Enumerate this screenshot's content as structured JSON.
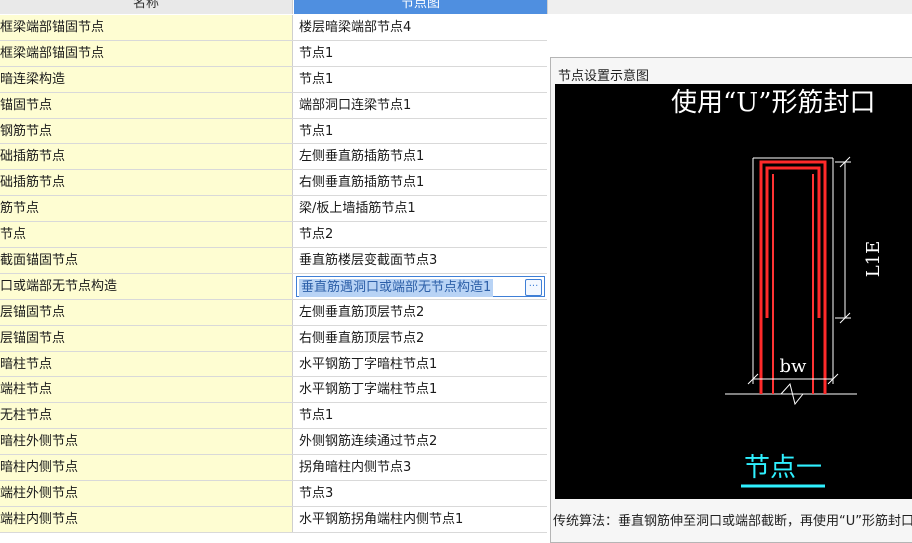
{
  "table": {
    "headers": {
      "name": "名称",
      "diagram": "节点图"
    },
    "rows": [
      {
        "name": "框梁端部锚固节点",
        "value": "楼层暗梁端部节点4"
      },
      {
        "name": "框梁端部锚固节点",
        "value": "节点1"
      },
      {
        "name": "暗连梁构造",
        "value": "节点1"
      },
      {
        "name": "锚固节点",
        "value": "端部洞口连梁节点1"
      },
      {
        "name": "钢筋节点",
        "value": "节点1"
      },
      {
        "name": "础插筋节点",
        "value": "左侧垂直筋插筋节点1"
      },
      {
        "name": "础插筋节点",
        "value": "右侧垂直筋插筋节点1"
      },
      {
        "name": "筋节点",
        "value": "梁/板上墙插筋节点1"
      },
      {
        "name": "节点",
        "value": "节点2"
      },
      {
        "name": "截面锚固节点",
        "value": "垂直筋楼层变截面节点3"
      },
      {
        "name": "口或端部无节点构造",
        "value": "垂直筋遇洞口或端部无节点构造1",
        "selected": true
      },
      {
        "name": "层锚固节点",
        "value": "左侧垂直筋顶层节点2"
      },
      {
        "name": "层锚固节点",
        "value": "右侧垂直筋顶层节点2"
      },
      {
        "name": "暗柱节点",
        "value": "水平钢筋丁字暗柱节点1"
      },
      {
        "name": "端柱节点",
        "value": "水平钢筋丁字端柱节点1"
      },
      {
        "name": "无柱节点",
        "value": "节点1"
      },
      {
        "name": "暗柱外侧节点",
        "value": "外侧钢筋连续通过节点2"
      },
      {
        "name": "暗柱内侧节点",
        "value": "拐角暗柱内侧节点3"
      },
      {
        "name": "端柱外侧节点",
        "value": "节点3"
      },
      {
        "name": "端柱内侧节点",
        "value": "水平钢筋拐角端柱内侧节点1"
      }
    ]
  },
  "preview": {
    "title": "节点设置示意图",
    "drawing_title": "使用“U”形筋封口",
    "dim_vertical": "L1E",
    "dim_width": "bw",
    "node_label": "节点一",
    "description": "传统算法：垂直钢筋伸至洞口或端部截断，再使用“U”形筋封口"
  },
  "colors": {
    "name_cell_bg": "#fefdd2",
    "header_active_bg": "#4f8fe0",
    "selection_border": "#3f7fd6",
    "drawing_bg": "#000000",
    "rebar_red": "#ff2a2a",
    "node_label_cyan": "#2ff0ff"
  }
}
